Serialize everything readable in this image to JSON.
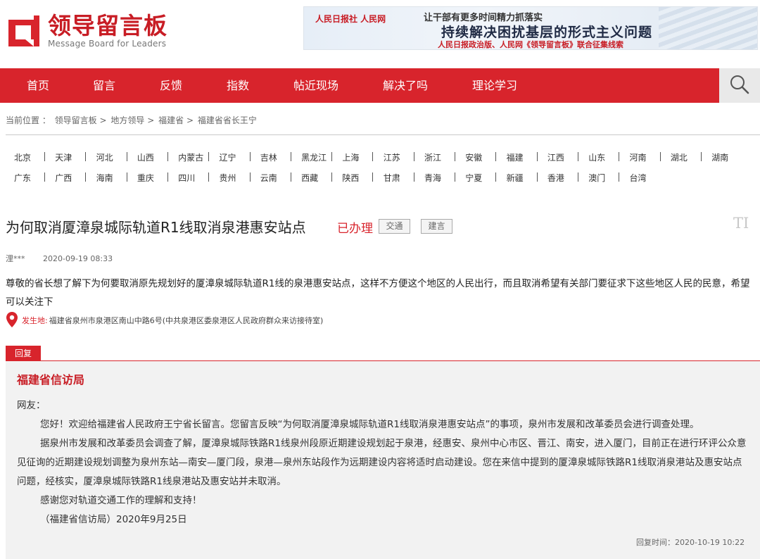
{
  "header": {
    "logo_title": "领导留言板",
    "logo_sub": "Message Board for Leaders",
    "banner": {
      "logos": "人民日报社  人民网",
      "line1": "让干部有更多时间精力抓落实",
      "line2": "持续解决困扰基层的形式主义问题",
      "line3": "人民日报政治版、人民网《领导留言板》联合征集线索"
    }
  },
  "nav": {
    "items": [
      "首页",
      "留言",
      "反馈",
      "指数",
      "帖近现场",
      "解决了吗",
      "理论学习"
    ]
  },
  "breadcrumb": {
    "prefix": "当前位置 ：",
    "items": [
      "领导留言板",
      "地方领导",
      "福建省",
      "福建省省长王宁"
    ],
    "separator": ">"
  },
  "provinces": {
    "row1": [
      "北京",
      "天津",
      "河北",
      "山西",
      "内蒙古",
      "辽宁",
      "吉林",
      "黑龙江",
      "上海",
      "江苏",
      "浙江",
      "安徽",
      "福建",
      "江西",
      "山东",
      "河南",
      "湖北",
      "湖南"
    ],
    "row2": [
      "广东",
      "广西",
      "海南",
      "重庆",
      "四川",
      "贵州",
      "云南",
      "西藏",
      "陕西",
      "甘肃",
      "青海",
      "宁夏",
      "新疆",
      "香港",
      "澳门",
      "台湾"
    ]
  },
  "message": {
    "title": "为何取消厦漳泉城际轨道R1线取消泉港惠安站点",
    "status": "已办理",
    "tags": [
      "交通",
      "建言"
    ],
    "author": "浬***",
    "date": "2020-09-19 08:33",
    "content": "尊敬的省长想了解下为何要取消原先规划好的厦漳泉城际轨道R1线的泉港惠安站点，这样不方便这个地区的人民出行，而且取消希望有关部门要征求下这些地区人民的民意，希望可以关注下",
    "location_label": "发生地:",
    "location": "福建省泉州市泉港区南山中路6号(中共泉港区委泉港区人民政府群众来访接待室)"
  },
  "reply": {
    "tab_label": "回复",
    "org": "福建省信访局",
    "greeting": "网友：",
    "paragraphs": [
      "您好！欢迎给福建省人民政府王宁省长留言。您留言反映“为何取消厦漳泉城际轨道R1线取消泉港惠安站点”的事项，泉州市发展和改革委员会进行调查处理。",
      "据泉州市发展和改革委员会调查了解，厦漳泉城际铁路R1线泉州段原近期建设规划起于泉港，经惠安、泉州中心市区、晋江、南安，进入厦门，目前正在进行环评公众意见征询的近期建设规划调整为泉州东站—南安—厦门段，泉港—泉州东站段作为远期建设内容将适时启动建设。您在来信中提到的厦漳泉城际铁路R1线取消泉港站及惠安站点问题，经核实，厦漳泉城际铁路R1线泉港站及惠安站并未取消。",
      "感谢您对轨道交通工作的理解和支持！",
      "（福建省信访局）2020年9月25日"
    ],
    "time_label": "回复时间：",
    "time": "2020-10-19 10:22"
  },
  "colors": {
    "brand_red": "#d8242c",
    "search_bg": "#e9e9e9",
    "reply_bg": "#f2f2f2"
  },
  "icons": {
    "logo": "message-board-logo-icon",
    "search": "search-icon",
    "location": "location-pin-icon",
    "font_size": "font-size-icon"
  }
}
